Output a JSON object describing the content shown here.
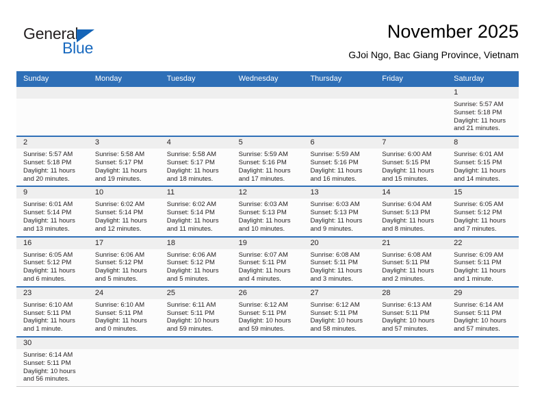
{
  "brand": {
    "line1": "General",
    "line2": "Blue",
    "triangle_icon": "blue-triangle-icon",
    "color_black": "#231f20",
    "color_blue": "#1869bf"
  },
  "header": {
    "title": "November 2025",
    "subtitle": "GJoi Ngo, Bac Giang Province, Vietnam"
  },
  "theme": {
    "header_blue": "#2e6fb7",
    "daynum_gray": "#efefef",
    "cell_white": "#fcfcfc"
  },
  "calendar": {
    "weekdays": [
      "Sunday",
      "Monday",
      "Tuesday",
      "Wednesday",
      "Thursday",
      "Friday",
      "Saturday"
    ],
    "weeks": [
      [
        {
          "blank": true
        },
        {
          "blank": true
        },
        {
          "blank": true
        },
        {
          "blank": true
        },
        {
          "blank": true
        },
        {
          "blank": true
        },
        {
          "day": "1",
          "sunrise": "Sunrise: 5:57 AM",
          "sunset": "Sunset: 5:18 PM",
          "daylight1": "Daylight: 11 hours",
          "daylight2": "and 21 minutes."
        }
      ],
      [
        {
          "day": "2",
          "sunrise": "Sunrise: 5:57 AM",
          "sunset": "Sunset: 5:18 PM",
          "daylight1": "Daylight: 11 hours",
          "daylight2": "and 20 minutes."
        },
        {
          "day": "3",
          "sunrise": "Sunrise: 5:58 AM",
          "sunset": "Sunset: 5:17 PM",
          "daylight1": "Daylight: 11 hours",
          "daylight2": "and 19 minutes."
        },
        {
          "day": "4",
          "sunrise": "Sunrise: 5:58 AM",
          "sunset": "Sunset: 5:17 PM",
          "daylight1": "Daylight: 11 hours",
          "daylight2": "and 18 minutes."
        },
        {
          "day": "5",
          "sunrise": "Sunrise: 5:59 AM",
          "sunset": "Sunset: 5:16 PM",
          "daylight1": "Daylight: 11 hours",
          "daylight2": "and 17 minutes."
        },
        {
          "day": "6",
          "sunrise": "Sunrise: 5:59 AM",
          "sunset": "Sunset: 5:16 PM",
          "daylight1": "Daylight: 11 hours",
          "daylight2": "and 16 minutes."
        },
        {
          "day": "7",
          "sunrise": "Sunrise: 6:00 AM",
          "sunset": "Sunset: 5:15 PM",
          "daylight1": "Daylight: 11 hours",
          "daylight2": "and 15 minutes."
        },
        {
          "day": "8",
          "sunrise": "Sunrise: 6:01 AM",
          "sunset": "Sunset: 5:15 PM",
          "daylight1": "Daylight: 11 hours",
          "daylight2": "and 14 minutes."
        }
      ],
      [
        {
          "day": "9",
          "sunrise": "Sunrise: 6:01 AM",
          "sunset": "Sunset: 5:14 PM",
          "daylight1": "Daylight: 11 hours",
          "daylight2": "and 13 minutes."
        },
        {
          "day": "10",
          "sunrise": "Sunrise: 6:02 AM",
          "sunset": "Sunset: 5:14 PM",
          "daylight1": "Daylight: 11 hours",
          "daylight2": "and 12 minutes."
        },
        {
          "day": "11",
          "sunrise": "Sunrise: 6:02 AM",
          "sunset": "Sunset: 5:14 PM",
          "daylight1": "Daylight: 11 hours",
          "daylight2": "and 11 minutes."
        },
        {
          "day": "12",
          "sunrise": "Sunrise: 6:03 AM",
          "sunset": "Sunset: 5:13 PM",
          "daylight1": "Daylight: 11 hours",
          "daylight2": "and 10 minutes."
        },
        {
          "day": "13",
          "sunrise": "Sunrise: 6:03 AM",
          "sunset": "Sunset: 5:13 PM",
          "daylight1": "Daylight: 11 hours",
          "daylight2": "and 9 minutes."
        },
        {
          "day": "14",
          "sunrise": "Sunrise: 6:04 AM",
          "sunset": "Sunset: 5:13 PM",
          "daylight1": "Daylight: 11 hours",
          "daylight2": "and 8 minutes."
        },
        {
          "day": "15",
          "sunrise": "Sunrise: 6:05 AM",
          "sunset": "Sunset: 5:12 PM",
          "daylight1": "Daylight: 11 hours",
          "daylight2": "and 7 minutes."
        }
      ],
      [
        {
          "day": "16",
          "sunrise": "Sunrise: 6:05 AM",
          "sunset": "Sunset: 5:12 PM",
          "daylight1": "Daylight: 11 hours",
          "daylight2": "and 6 minutes."
        },
        {
          "day": "17",
          "sunrise": "Sunrise: 6:06 AM",
          "sunset": "Sunset: 5:12 PM",
          "daylight1": "Daylight: 11 hours",
          "daylight2": "and 5 minutes."
        },
        {
          "day": "18",
          "sunrise": "Sunrise: 6:06 AM",
          "sunset": "Sunset: 5:12 PM",
          "daylight1": "Daylight: 11 hours",
          "daylight2": "and 5 minutes."
        },
        {
          "day": "19",
          "sunrise": "Sunrise: 6:07 AM",
          "sunset": "Sunset: 5:11 PM",
          "daylight1": "Daylight: 11 hours",
          "daylight2": "and 4 minutes."
        },
        {
          "day": "20",
          "sunrise": "Sunrise: 6:08 AM",
          "sunset": "Sunset: 5:11 PM",
          "daylight1": "Daylight: 11 hours",
          "daylight2": "and 3 minutes."
        },
        {
          "day": "21",
          "sunrise": "Sunrise: 6:08 AM",
          "sunset": "Sunset: 5:11 PM",
          "daylight1": "Daylight: 11 hours",
          "daylight2": "and 2 minutes."
        },
        {
          "day": "22",
          "sunrise": "Sunrise: 6:09 AM",
          "sunset": "Sunset: 5:11 PM",
          "daylight1": "Daylight: 11 hours",
          "daylight2": "and 1 minute."
        }
      ],
      [
        {
          "day": "23",
          "sunrise": "Sunrise: 6:10 AM",
          "sunset": "Sunset: 5:11 PM",
          "daylight1": "Daylight: 11 hours",
          "daylight2": "and 1 minute."
        },
        {
          "day": "24",
          "sunrise": "Sunrise: 6:10 AM",
          "sunset": "Sunset: 5:11 PM",
          "daylight1": "Daylight: 11 hours",
          "daylight2": "and 0 minutes."
        },
        {
          "day": "25",
          "sunrise": "Sunrise: 6:11 AM",
          "sunset": "Sunset: 5:11 PM",
          "daylight1": "Daylight: 10 hours",
          "daylight2": "and 59 minutes."
        },
        {
          "day": "26",
          "sunrise": "Sunrise: 6:12 AM",
          "sunset": "Sunset: 5:11 PM",
          "daylight1": "Daylight: 10 hours",
          "daylight2": "and 59 minutes."
        },
        {
          "day": "27",
          "sunrise": "Sunrise: 6:12 AM",
          "sunset": "Sunset: 5:11 PM",
          "daylight1": "Daylight: 10 hours",
          "daylight2": "and 58 minutes."
        },
        {
          "day": "28",
          "sunrise": "Sunrise: 6:13 AM",
          "sunset": "Sunset: 5:11 PM",
          "daylight1": "Daylight: 10 hours",
          "daylight2": "and 57 minutes."
        },
        {
          "day": "29",
          "sunrise": "Sunrise: 6:14 AM",
          "sunset": "Sunset: 5:11 PM",
          "daylight1": "Daylight: 10 hours",
          "daylight2": "and 57 minutes."
        }
      ],
      [
        {
          "day": "30",
          "sunrise": "Sunrise: 6:14 AM",
          "sunset": "Sunset: 5:11 PM",
          "daylight1": "Daylight: 10 hours",
          "daylight2": "and 56 minutes."
        },
        {
          "blank": true
        },
        {
          "blank": true
        },
        {
          "blank": true
        },
        {
          "blank": true
        },
        {
          "blank": true
        },
        {
          "blank": true
        }
      ]
    ]
  }
}
